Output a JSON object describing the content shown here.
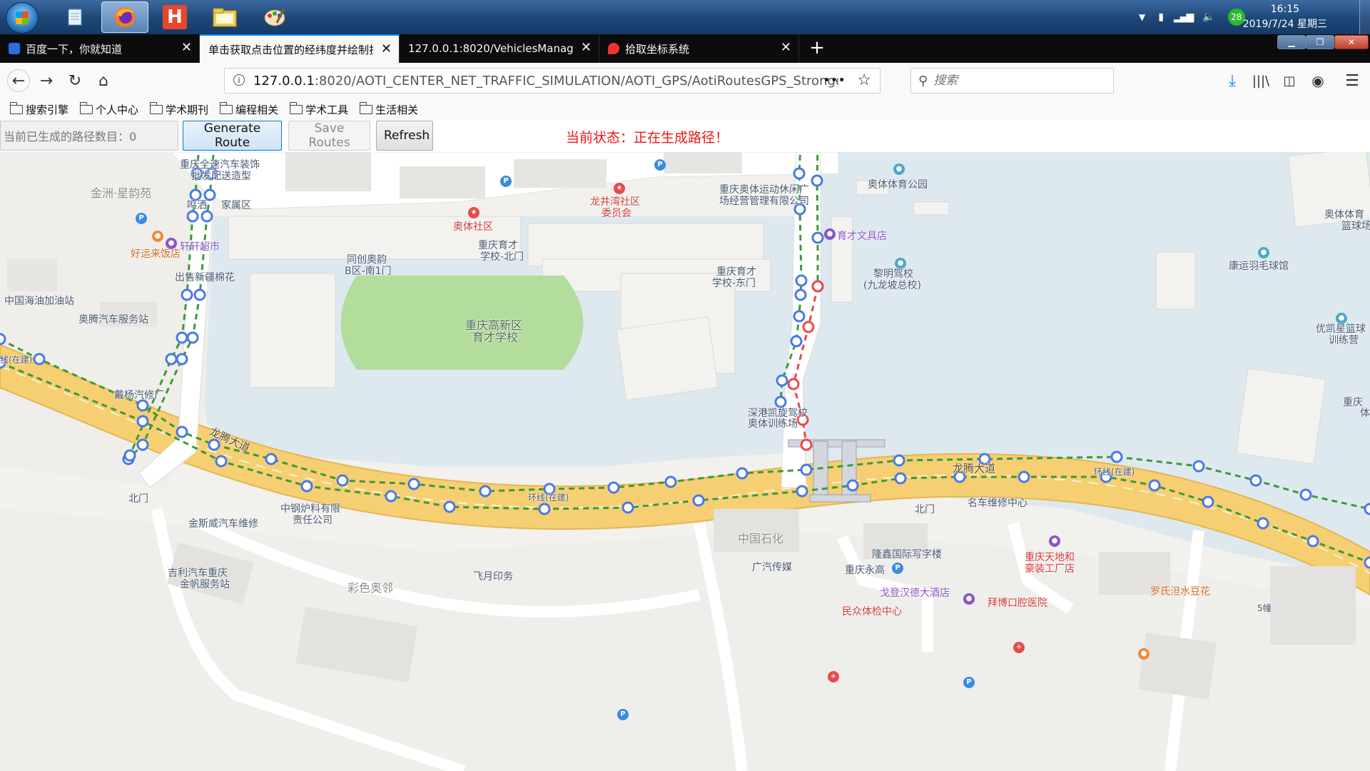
{
  "taskbar": {
    "clock_time": "16:15",
    "clock_date": "2019/7/24 星期三",
    "notification_count": "28"
  },
  "browser": {
    "tabs": [
      {
        "title": "百度一下，你就知道"
      },
      {
        "title": "单击获取点击位置的经纬度并绘制折线"
      },
      {
        "title": "127.0.0.1:8020/VehiclesManagement"
      },
      {
        "title": "拾取坐标系统"
      }
    ],
    "url_host": "127.0.0.1",
    "url_rest": ":8020/AOTI_CENTER_NET_TRAFFIC_SIMULATION/AOTI_GPS/AotiRoutesGPS_StrongerEdit.html",
    "search_placeholder": "搜索",
    "bookmarks": [
      "搜索引擎",
      "个人中心",
      "学术期刊",
      "编程相关",
      "学术工具",
      "生活相关"
    ]
  },
  "controls": {
    "route_count": "当前已生成的路径数目：0",
    "generate_label": "Generate Route",
    "save_label": "Save Routes",
    "refresh_label": "Refresh",
    "status": "当前状态：正在生成路径！"
  },
  "map": {
    "labels": {
      "l1": "重庆全速汽车装饰",
      "l2": "批发配送造型",
      "l3": "金洲·星韵苑",
      "l4": "鸣洒",
      "l5": "家属区",
      "l6": "好运来饭店",
      "l7": "奥体社区",
      "l8": "龙井湾社区",
      "l9": "委员会",
      "l10": "重庆奥体运动休闲广",
      "l11": "场经营管理有限公司",
      "l12": "奥体体育公园",
      "l13": "奥体体育",
      "l14": "篮球场",
      "l15": "同创奥韵",
      "l16": "B区-南1门",
      "l17": "轩轩超市",
      "l18": "重庆育才",
      "l19": "学校-北门",
      "l20": "育才文具店",
      "l21": "出售新疆棉花",
      "l22": "重庆育才",
      "l23": "学校-东门",
      "l24": "黎明驾校",
      "l25": "(九龙坡总校)",
      "l26": "康运羽毛球馆",
      "l27": "中国海油加油站",
      "l28": "奥腾汽车服务站",
      "l29": "重庆高新区",
      "l30": "育才学校",
      "l31": "优凯星篮球",
      "l32": "训练营",
      "l33": "戴杨汽修厂",
      "l34": "深港凯旋驾校",
      "l35": "奥体训练场",
      "l36": "重庆",
      "l37": "体",
      "l38": "龙腾大道",
      "l39": "龙腾大道",
      "l40": "环线(在建)",
      "l41": "环线(在建)",
      "l42": "北门",
      "l43": "中钢炉料有限",
      "l44": "责任公司",
      "l45": "北门",
      "l46": "名车维修中心",
      "l47": "金斯威汽车维修",
      "l48": "中国石化",
      "l49": "隆鑫国际写字楼",
      "l50": "重庆天地和",
      "l51": "豪装工厂店",
      "l52": "广汽传媒",
      "l53": "重庆永高",
      "l54": "吉利汽车重庆",
      "l55": "金帆服务站",
      "l56": "飞月印务",
      "l57": "彩色奥邻",
      "l58": "戈登汉德大酒店",
      "l59": "拜博口腔医院",
      "l60": "罗氏泹水豆花",
      "l61": "民众体检中心",
      "l62": "线(在建)",
      "l63": "5幢"
    }
  },
  "colors": {
    "status_red": "#f01414",
    "route_green": "#3a9a3a",
    "route_red": "#e84a4a",
    "marker_blue": "#4a78e8",
    "road_yellow": "#f6cf72",
    "water": "#dde9ef",
    "grass": "#b2dd9c"
  }
}
